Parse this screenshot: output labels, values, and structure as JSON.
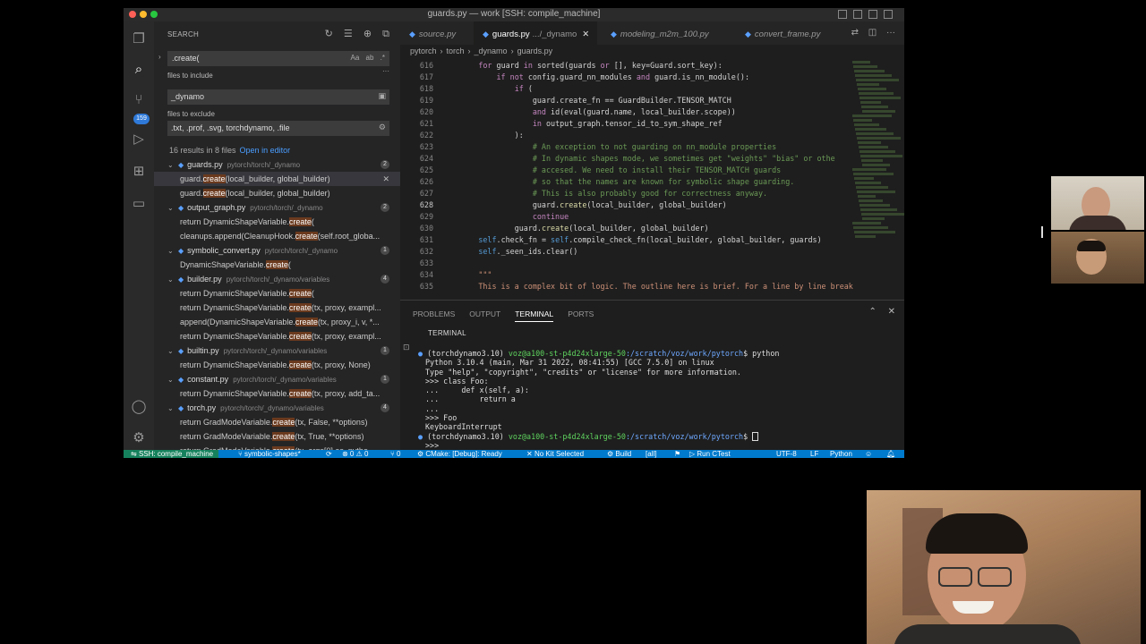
{
  "window": {
    "title": "guards.py — work [SSH: compile_machine]"
  },
  "activity_badge": "159",
  "search": {
    "header": "SEARCH",
    "query": ".create(",
    "opt_case": "Aa",
    "opt_word": "ab",
    "opt_regex": ".*",
    "include_label": "files to include",
    "include_value": "_dynamo",
    "exclude_label": "files to exclude",
    "exclude_value": ".txt, .prof, .svg, torchdynamo, .file",
    "summary": "16 results in 8 files",
    "open_in_editor": "Open in editor"
  },
  "results": [
    {
      "kind": "file",
      "name": "guards.py",
      "path": "pytorch/torch/_dynamo",
      "count": "2"
    },
    {
      "kind": "match",
      "pre": "guard.",
      "hl": "create",
      "post": "(local_builder, global_builder)",
      "selected": true
    },
    {
      "kind": "match",
      "pre": "guard.",
      "hl": "create",
      "post": "(local_builder, global_builder)"
    },
    {
      "kind": "file",
      "name": "output_graph.py",
      "path": "pytorch/torch/_dynamo",
      "count": "2"
    },
    {
      "kind": "match",
      "pre": "return DynamicShapeVariable.",
      "hl": "create",
      "post": "("
    },
    {
      "kind": "match",
      "pre": "cleanups.append(CleanupHook.",
      "hl": "create",
      "post": "(self.root_globa..."
    },
    {
      "kind": "file",
      "name": "symbolic_convert.py",
      "path": "pytorch/torch/_dynamo",
      "count": "1"
    },
    {
      "kind": "match",
      "pre": "DynamicShapeVariable.",
      "hl": "create",
      "post": "("
    },
    {
      "kind": "file",
      "name": "builder.py",
      "path": "pytorch/torch/_dynamo/variables",
      "count": "4"
    },
    {
      "kind": "match",
      "pre": "return DynamicShapeVariable.",
      "hl": "create",
      "post": "("
    },
    {
      "kind": "match",
      "pre": "return DynamicShapeVariable.",
      "hl": "create",
      "post": "(tx, proxy, exampl..."
    },
    {
      "kind": "match",
      "pre": "append(DynamicShapeVariable.",
      "hl": "create",
      "post": "(tx, proxy_i, v, *..."
    },
    {
      "kind": "match",
      "pre": "return DynamicShapeVariable.",
      "hl": "create",
      "post": "(tx, proxy, exampl..."
    },
    {
      "kind": "file",
      "name": "builtin.py",
      "path": "pytorch/torch/_dynamo/variables",
      "count": "1"
    },
    {
      "kind": "match",
      "pre": "return DynamicShapeVariable.",
      "hl": "create",
      "post": "(tx, proxy, None)"
    },
    {
      "kind": "file",
      "name": "constant.py",
      "path": "pytorch/torch/_dynamo/variables",
      "count": "1"
    },
    {
      "kind": "match",
      "pre": "return DynamicShapeVariable.",
      "hl": "create",
      "post": "(tx, proxy, add_ta..."
    },
    {
      "kind": "file",
      "name": "torch.py",
      "path": "pytorch/torch/_dynamo/variables",
      "count": "4"
    },
    {
      "kind": "match",
      "pre": "return GradModeVariable.",
      "hl": "create",
      "post": "(tx, False, **options)"
    },
    {
      "kind": "match",
      "pre": "return GradModeVariable.",
      "hl": "create",
      "post": "(tx, True, **options)"
    },
    {
      "kind": "match",
      "pre": "return GradModeVariable.",
      "hl": "create",
      "post": "(tx, args[0].as_pytho..."
    }
  ],
  "tabs": [
    {
      "name": "source.py",
      "sub": "",
      "active": false
    },
    {
      "name": "guards.py",
      "sub": ".../_dynamo",
      "active": true
    },
    {
      "name": "modeling_m2m_100.py",
      "sub": "",
      "active": false
    },
    {
      "name": "convert_frame.py",
      "sub": "",
      "active": false
    }
  ],
  "breadcrumb": [
    "pytorch",
    "torch",
    "_dynamo",
    "guards.py"
  ],
  "code": [
    {
      "n": "616",
      "t": "        for guard in sorted(guards or [], key=Guard.sort_key):"
    },
    {
      "n": "617",
      "t": "            if not config.guard_nn_modules and guard.is_nn_module():"
    },
    {
      "n": "618",
      "t": "                if ("
    },
    {
      "n": "619",
      "t": "                    guard.create_fn == GuardBuilder.TENSOR_MATCH"
    },
    {
      "n": "620",
      "t": "                    and id(eval(guard.name, local_builder.scope))"
    },
    {
      "n": "621",
      "t": "                    in output_graph.tensor_id_to_sym_shape_ref"
    },
    {
      "n": "622",
      "t": "                ):"
    },
    {
      "n": "623",
      "t": "                    # An exception to not guarding on nn_module properties"
    },
    {
      "n": "624",
      "t": "                    # In dynamic shapes mode, we sometimes get \"weights\" \"bias\" or othe"
    },
    {
      "n": "625",
      "t": "                    # accesed. We need to install their TENSOR_MATCH guards"
    },
    {
      "n": "626",
      "t": "                    # so that the names are known for symbolic shape guarding."
    },
    {
      "n": "627",
      "t": "                    # This is also probably good for correctness anyway."
    },
    {
      "n": "628",
      "t": "                    guard.create(local_builder, global_builder)"
    },
    {
      "n": "629",
      "t": "                    continue"
    },
    {
      "n": "630",
      "t": "                guard.create(local_builder, global_builder)"
    },
    {
      "n": "631",
      "t": "        self.check_fn = self.compile_check_fn(local_builder, global_builder, guards)"
    },
    {
      "n": "632",
      "t": "        self._seen_ids.clear()"
    },
    {
      "n": "633",
      "t": ""
    },
    {
      "n": "634",
      "t": "        \"\"\""
    },
    {
      "n": "635",
      "t": "        This is a complex bit of logic. The outline here is brief. For a line by line break"
    }
  ],
  "panel": {
    "tabs": [
      "PROBLEMS",
      "OUTPUT",
      "TERMINAL",
      "PORTS"
    ],
    "active": "TERMINAL",
    "terminal_label": "TERMINAL"
  },
  "terminal": {
    "env": "(torchdynamo3.10)",
    "host": "voz@a100-st-p4d24xlarge-50",
    "cwd": ":/scratch/voz/work/pytorch",
    "cmd": "$ python",
    "lines": [
      "Python 3.10.4 (main, Mar 31 2022, 08:41:55) [GCC 7.5.0] on linux",
      "Type \"help\", \"copyright\", \"credits\" or \"license\" for more information.",
      ">>> class Foo:",
      "...     def x(self, a):",
      "...         return a",
      "...",
      ">>> Foo",
      "KeyboardInterrupt",
      ">>>"
    ],
    "prompt_end": "$ "
  },
  "status": {
    "remote": "SSH: compile_machine",
    "branch": "symbolic-shapes*",
    "sync": "⟳",
    "errors": "⊗ 0 ⚠ 0",
    "ports": "⑂ 0",
    "cmake": "CMake: [Debug]: Ready",
    "kit": "No Kit Selected",
    "build": "Build",
    "all": "[all]",
    "ctest": "Run CTest",
    "encoding": "UTF-8",
    "eol": "LF",
    "language": "Python"
  },
  "colors": {
    "status_bar": "#007acc",
    "remote": "#16825d",
    "match_highlight": "#6b3a1e",
    "keyword": "#c586c0",
    "comment": "#6a9955"
  },
  "icons": [
    "explorer-icon",
    "search-icon",
    "source-control-icon",
    "run-debug-icon",
    "extensions-icon",
    "remote-icon",
    "account-icon",
    "gear-icon"
  ]
}
